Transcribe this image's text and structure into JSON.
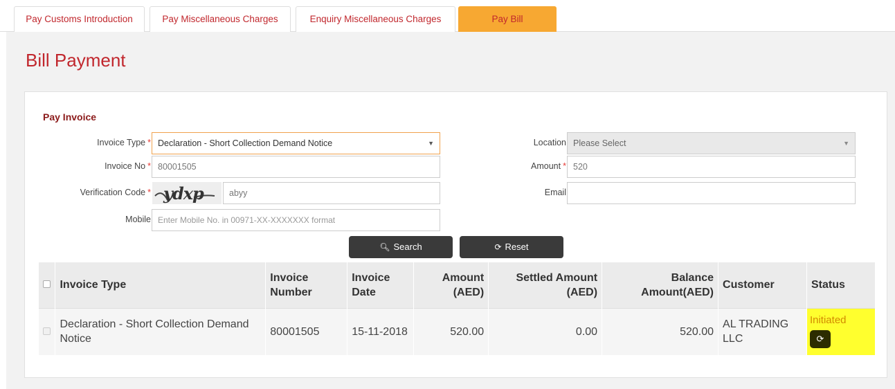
{
  "tabs": [
    {
      "label": "Pay Customs Introduction",
      "active": false
    },
    {
      "label": "Pay Miscellaneous Charges",
      "active": false
    },
    {
      "label": "Enquiry Miscellaneous Charges",
      "active": false
    },
    {
      "label": "Pay Bill",
      "active": true
    }
  ],
  "page": {
    "title": "Bill Payment"
  },
  "form": {
    "section_title": "Pay Invoice",
    "invoice_type": {
      "label": "Invoice Type",
      "value": "Declaration - Short Collection Demand Notice"
    },
    "invoice_no": {
      "label": "Invoice No",
      "value": "80001505"
    },
    "verification_code": {
      "label": "Verification Code",
      "captcha_text": "rydxp",
      "value": "abyy"
    },
    "mobile": {
      "label": "Mobile",
      "placeholder": "Enter Mobile No. in 00971-XX-XXXXXXX format"
    },
    "location": {
      "label": "Location",
      "value": "Please Select"
    },
    "amount": {
      "label": "Amount",
      "value": "520"
    },
    "email": {
      "label": "Email",
      "value": ""
    },
    "required_mark": "*",
    "search_label": "Search",
    "reset_label": "Reset"
  },
  "table": {
    "headers": {
      "invoice_type": "Invoice Type",
      "invoice_number": "Invoice Number",
      "invoice_date": "Invoice Date",
      "amount": "Amount (AED)",
      "settled_amount": "Settled Amount (AED)",
      "balance_amount": "Balance Amount(AED)",
      "customer": "Customer",
      "status": "Status"
    },
    "rows": [
      {
        "invoice_type": "Declaration - Short Collection Demand Notice",
        "invoice_number": "80001505",
        "invoice_date": "15-11-2018",
        "amount": "520.00",
        "settled_amount": "0.00",
        "balance_amount": "520.00",
        "customer": "AL TRADING LLC",
        "status": "Initiated"
      }
    ]
  },
  "icons": {
    "search": "search-icon",
    "reset": "refresh-icon",
    "dropdown": "caret-down-icon",
    "status_action": "refresh-icon"
  },
  "colors": {
    "brand_red": "#c1272d",
    "active_tab": "#f7a832",
    "button": "#3a3a3a",
    "highlight": "#ffff2e"
  }
}
